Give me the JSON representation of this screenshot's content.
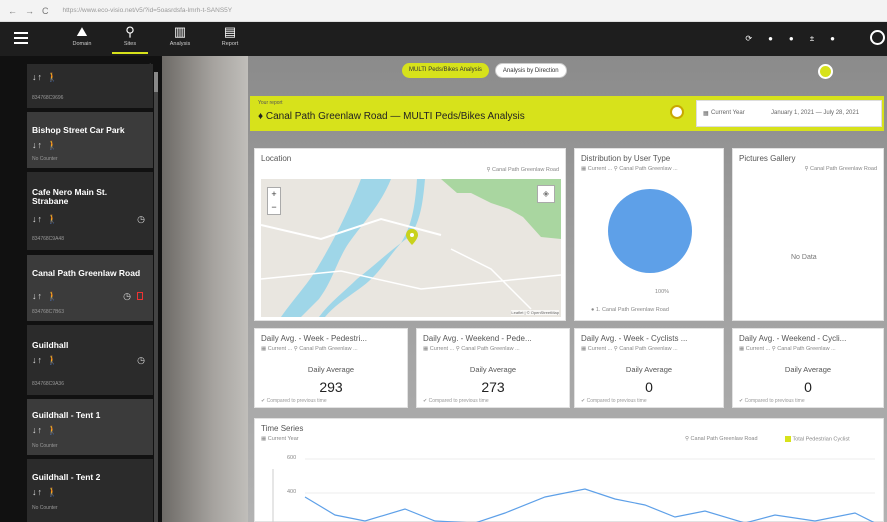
{
  "browser": {
    "nav": [
      "←",
      "→",
      "C"
    ],
    "url": "https://www.eco-visio.net/v5/?id=5oasrdsfa-lmrh-t-SANS5Y"
  },
  "appbar": {
    "nav": [
      {
        "icon": "mountain-bike-icon",
        "glyph": "⛰",
        "label": "Domain"
      },
      {
        "icon": "location-pin-icon",
        "glyph": "⚲",
        "label": "Sites"
      },
      {
        "icon": "bar-chart-icon",
        "glyph": "▥",
        "label": "Analysis"
      },
      {
        "icon": "report-document-icon",
        "glyph": "▤",
        "label": "Report"
      }
    ],
    "right_icons": [
      "⟳",
      "●",
      "●",
      "±",
      "●"
    ]
  },
  "sidebar": {
    "collapse": "‹",
    "items": [
      {
        "title": "",
        "icons": "↓↑ 🚶",
        "sub": "834768C9696"
      },
      {
        "title": "Bishop Street Car Park",
        "icons": "↓↑ 🚶",
        "sub": "No Counter"
      },
      {
        "title": "Cafe Nero Main St. Strabane",
        "icons": "↓↑ 🚶",
        "sub": "834768C9A48",
        "clock": "◷"
      },
      {
        "title": "Canal Path Greenlaw Road",
        "icons": "↓↑ 🚶",
        "sub": "834768C7B63",
        "clock": "◷"
      },
      {
        "title": "Guildhall",
        "icons": "↓↑ 🚶",
        "sub": "834768C9A36",
        "clock": "◷"
      },
      {
        "title": "Guildhall - Tent 1",
        "icons": "↓↑ 🚶",
        "sub": "No Counter"
      },
      {
        "title": "Guildhall - Tent 2",
        "icons": "↓↑ 🚶",
        "sub": "No Counter"
      }
    ]
  },
  "toggles": {
    "multi": "MULTI Peds/Bikes Analysis",
    "direction": "Analysis by Direction"
  },
  "header": {
    "super": "Your report",
    "title": "♦ Canal Path Greenlaw Road — MULTI Peds/Bikes Analysis",
    "period_label": "Current Year",
    "range": "January 1, 2021 — July 28, 2021"
  },
  "location": {
    "title": "Location",
    "tag": "⚲ Canal Path Greenlaw Road",
    "zoom_in": "+",
    "zoom_out": "−",
    "credit": "Leaflet | © OpenStreetMap"
  },
  "distribution": {
    "title": "Distribution by User Type",
    "sub": "▦ Current ... ⚲ Canal Path Greenlaw ...",
    "percent": "100%",
    "legend": "● 1. Canal Path Greenlaw Road"
  },
  "gallery": {
    "title": "Pictures Gallery",
    "tag": "⚲ Canal Path Greenlaw Road",
    "no_data": "No Data"
  },
  "kpis": [
    {
      "title": "Daily Avg. - Week - Pedestri...",
      "sub": "▦ Current ... ⚲ Canal Path Greenlaw ...",
      "label": "Daily Average",
      "value": "293",
      "compare": "✔ Compared to previous time"
    },
    {
      "title": "Daily Avg. - Weekend - Pede...",
      "sub": "▦ Current ... ⚲ Canal Path Greenlaw ...",
      "label": "Daily Average",
      "value": "273",
      "compare": "✔ Compared to previous time"
    },
    {
      "title": "Daily Avg. - Week - Cyclists ...",
      "sub": "▦ Current ... ⚲ Canal Path Greenlaw ...",
      "label": "Daily Average",
      "value": "0",
      "compare": "✔ Compared to previous time"
    },
    {
      "title": "Daily Avg. - Weekend - Cycli...",
      "sub": "▦ Current ... ⚲ Canal Path Greenlaw ...",
      "label": "Daily Average",
      "value": "0",
      "compare": "✔ Compared to previous time"
    }
  ],
  "timeseries": {
    "title": "Time Series",
    "sub": "▦ Current Year",
    "tag": "⚲ Canal Path Greenlaw Road",
    "legend": "Total Pedestrian Cyclist",
    "y_ticks": [
      "600",
      "400"
    ]
  },
  "chart_data": {
    "type": "pie",
    "categories": [
      "1. Canal Path Greenlaw Road"
    ],
    "values": [
      100
    ],
    "labels": [
      "100%"
    ]
  },
  "colors": {
    "accent": "#d7e21b",
    "pie": "#5ea0e8",
    "line": "#5ea0e8",
    "river": "#9fd6e8",
    "park": "#a9d6a0"
  }
}
